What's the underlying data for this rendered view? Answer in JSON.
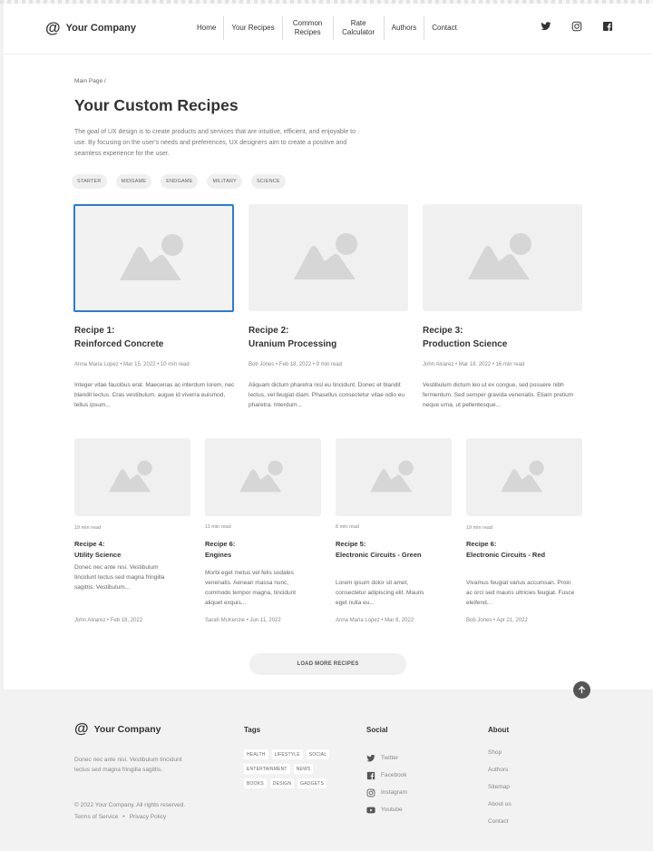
{
  "header": {
    "logo_symbol": "@",
    "logo_text": "Your Company",
    "nav": [
      "Home",
      "Your Recipes",
      "Common Recipes",
      "Rate Calculator",
      "Authors",
      "Contact"
    ],
    "social_icons": [
      "twitter-icon",
      "instagram-icon",
      "facebook-icon"
    ]
  },
  "intro": {
    "breadcrumb": "Main Page /",
    "title": "Your Custom Recipes",
    "description": "The goal of UX design is to create products and services that are intuitive, efficient, and enjoyable to use. By focusing on the user's needs and preferences, UX designers aim to create a positive and seamless experience for the user.",
    "tags": [
      "STARTER",
      "MIDGAME",
      "ENDGAME",
      "MILITARY",
      "SCIENCE"
    ]
  },
  "featured": [
    {
      "label": "Recipe 1:",
      "name": "Reinforced Concrete",
      "meta": "Anna Maria Lopez • Mar 15, 2022 • 10 min read",
      "excerpt": "Integer vitae faucibus erat. Maecenas ac interdum lorem, nec blandit lectus. Cras vestibulum, augue id viverra euismod, tellus ipsum..."
    },
    {
      "label": "Recipe 2:",
      "name": "Uranium Processing",
      "meta": "Bob Jones • Feb 18, 2022 • 9 min read",
      "excerpt": "Aliquam dictum pharetra nisl eu tincidunt. Donec et blandit lectus, vel feugiat diam. Phasellus consectetur vitae odio eu pharetra. Interdum..."
    },
    {
      "label": "Recipe 3:",
      "name": "Production Science",
      "meta": "John Alvarez • Mar 18, 2022 • 16 min read",
      "excerpt": "Vestibulum dictum leo ut ex congue, sed posuere nibh fermentum. Sed semper gravida venenatis. Etiam pretium neque urna, ut pellentesque..."
    }
  ],
  "recipes": [
    {
      "time": "19 min read",
      "label": "Recipe 4:",
      "name": "Utility Science",
      "excerpt": "Donec nec ante nisi. Vestibulum tincidunt lectus sed magna fringilla sagittis. Vestibulum...",
      "meta": "John Alvarez • Feb 18, 2022"
    },
    {
      "time": "11 min read",
      "label": "Recipe 6:",
      "name": "Engines",
      "excerpt": "Morbi eget metus vel felis sodales venenatis. Aenean massa nunc, commodo tempor magna, tincidunt aliquet exquis...",
      "meta": "Sarah McKenzie • Jun 11, 2022"
    },
    {
      "time": "8 min read",
      "label": "Recipe 5:",
      "name": "Electronic Circuits - Green",
      "excerpt": "Lorem ipsum dolor sit amet, consectetur adipiscing elit. Mauris eget nulla eu...",
      "meta": "Anna Maria Lopez • Mar 8, 2022"
    },
    {
      "time": "19 min read",
      "label": "Recipe 6:",
      "name": "Electronic Circuits - Red",
      "excerpt": "Vivamus feugiat varius accumsan. Proin ac orci sed mauris ultricies feugiat. Fusce eleifend...",
      "meta": "Bob Jones • Apr 21, 2022"
    }
  ],
  "load_more": "LOAD MORE RECIPES",
  "footer": {
    "logo_symbol": "@",
    "logo_text": "Your Company",
    "description": "Donec nec ante nisi. Vestibulum tincidunt lectus sed magna fringilla sagittis.",
    "copyright": "© 2022 Your Company.  All rights reserved.",
    "terms": "Terms of Service",
    "separator": "•",
    "privacy": "Privacy Policy",
    "tags_heading": "Tags",
    "tags": [
      "HEALTH",
      "LIFESTYLE",
      "SOCIAL",
      "ENTERTAINMENT",
      "NEWS",
      "BOOKS",
      "DESIGN",
      "GADGETS"
    ],
    "social_heading": "Social",
    "social": [
      {
        "label": "Twitter",
        "icon": "twitter-icon"
      },
      {
        "label": "Facebook",
        "icon": "facebook-icon"
      },
      {
        "label": "Instagram",
        "icon": "instagram-icon"
      },
      {
        "label": "Youtube",
        "icon": "youtube-icon"
      }
    ],
    "about_heading": "About",
    "about": [
      "Shop",
      "Authors",
      "Sitemap",
      "About us",
      "Contact"
    ]
  },
  "colors": {
    "accent": "#2b7bd8",
    "placeholder": "#f0f0f0",
    "dark_button": "#555555"
  }
}
